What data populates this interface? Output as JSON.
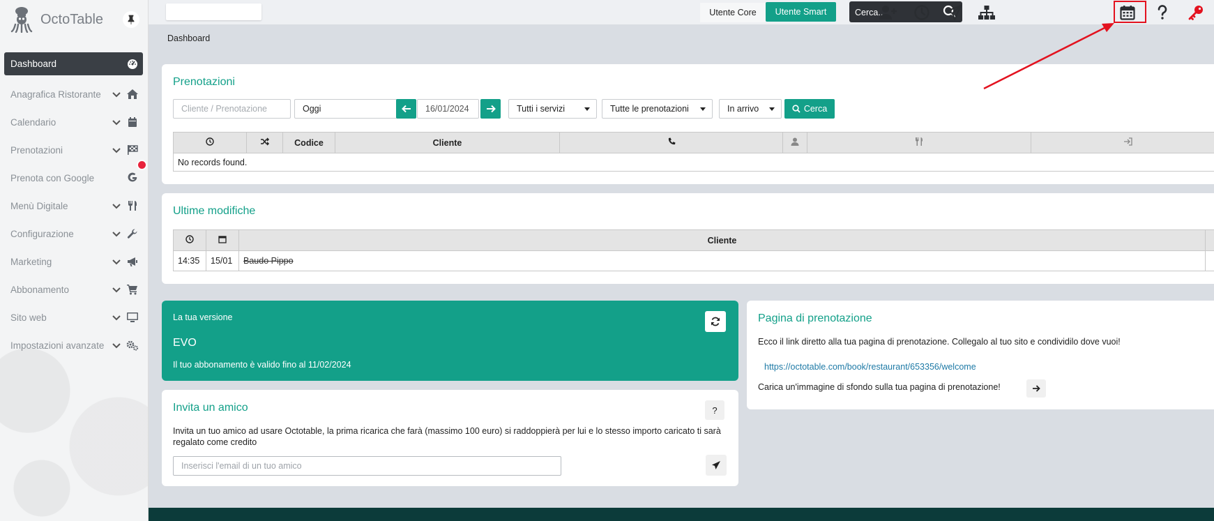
{
  "app": {
    "name": "OctoTable"
  },
  "sidebar": {
    "items": [
      {
        "label": "Dashboard",
        "icon": "dashboard-gauge-icon",
        "expandable": false,
        "active": true
      },
      {
        "label": "Anagrafica Ristorante",
        "icon": "home-icon",
        "expandable": true
      },
      {
        "label": "Calendario",
        "icon": "calendar-icon",
        "expandable": true
      },
      {
        "label": "Prenotazioni",
        "icon": "checkered-flag-icon",
        "expandable": true
      },
      {
        "label": "Prenota con Google",
        "icon": "google-icon",
        "expandable": false
      },
      {
        "label": "Menù Digitale",
        "icon": "utensils-icon",
        "expandable": true
      },
      {
        "label": "Configurazione",
        "icon": "wrench-icon",
        "expandable": true
      },
      {
        "label": "Marketing",
        "icon": "megaphone-icon",
        "expandable": true
      },
      {
        "label": "Abbonamento",
        "icon": "cart-icon",
        "expandable": true
      },
      {
        "label": "Sito web",
        "icon": "monitor-icon",
        "expandable": true
      },
      {
        "label": "Impostazioni avanzate",
        "icon": "gears-icon",
        "expandable": true
      }
    ]
  },
  "topbar": {
    "utente_core": "Utente Core",
    "utente_smart": "Utente Smart",
    "search_placeholder": "Cerca...",
    "icons": [
      "add-user-icon",
      "clock-icon",
      "paper-plane-icon",
      "sitemap-icon",
      "calendar-grid-icon",
      "question-icon",
      "key-icon"
    ]
  },
  "breadcrumb": "Dashboard",
  "prenotazioni": {
    "title": "Prenotazioni",
    "search_placeholder": "Cliente / Prenotazione",
    "period": "Oggi",
    "date": "16/01/2024",
    "servizi": "Tutti i servizi",
    "tipo": "Tutte le prenotazioni",
    "stato": "In arrivo",
    "cerca": "Cerca",
    "columns": {
      "codice": "Codice",
      "cliente": "Cliente"
    },
    "empty_message": "No records found."
  },
  "ultime_modifiche": {
    "title": "Ultime modifiche",
    "column_cliente": "Cliente",
    "rows": [
      {
        "time": "14:35",
        "date": "15/01",
        "cliente": "Baudo Pippo"
      }
    ]
  },
  "versione": {
    "label": "La tua versione",
    "name": "EVO",
    "validity": "Il tuo abbonamento è valido fino al 11/02/2024"
  },
  "invita": {
    "title": "Invita un amico",
    "help": "?",
    "text": "Invita un tuo amico ad usare Octotable, la prima ricarica che farà (massimo 100 euro) si raddoppierà per lui e lo stesso importo caricato ti sarà regalato come credito",
    "email_placeholder": "Inserisci l'email di un tuo amico"
  },
  "pagina": {
    "title": "Pagina di prenotazione",
    "description": "Ecco il link diretto alla tua pagina di prenotazione. Collegalo al tuo sito e condividilo dove vuoi!",
    "link": "https://octotable.com/book/restaurant/653356/welcome",
    "upload_text": "Carica un'immagine di sfondo sulla tua pagina di prenotazione!"
  },
  "colors": {
    "accent": "#13a089",
    "sidebar_active": "#3a3f45",
    "annotation": "#e3121f",
    "footer": "#0c3b3a"
  }
}
